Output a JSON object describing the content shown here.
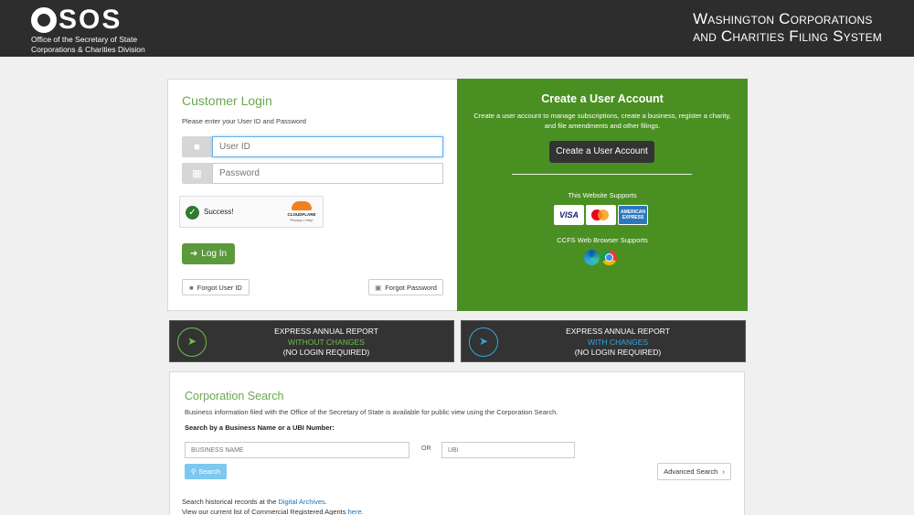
{
  "header": {
    "logo_text": "SOS",
    "logo_line1": "Office of the Secretary of State",
    "logo_line2": "Corporations & Charities Division",
    "title_line1": "Washington Corporations",
    "title_line2": "and Charities Filing System"
  },
  "login": {
    "title": "Customer Login",
    "subtitle": "Please enter your User ID and Password",
    "userid_placeholder": "User ID",
    "password_placeholder": "Password",
    "captcha_status": "Success!",
    "captcha_brand": "CLOUDFLARE",
    "captcha_links": "Privacy • Help",
    "login_button": "Log In",
    "forgot_userid": "Forgot User ID",
    "forgot_password": "Forgot Password"
  },
  "create": {
    "title": "Create a User Account",
    "description": "Create a user account to manage subscriptions, create a business, register a charity, and file amendments and other filings.",
    "button": "Create a User Account",
    "website_supports": "This Website Supports",
    "cards": [
      "VISA",
      "MasterCard",
      "AMERICAN EXPRESS"
    ],
    "browser_supports": "CCFS Web Browser Supports",
    "browsers": [
      "edge-icon",
      "chrome-icon"
    ]
  },
  "express": [
    {
      "line1": "EXPRESS ANNUAL REPORT",
      "line2": "WITHOUT CHANGES",
      "line3": "(NO LOGIN REQUIRED)",
      "accent": "#6cc04a"
    },
    {
      "line1": "EXPRESS ANNUAL REPORT",
      "line2": "WITH CHANGES",
      "line3": "(NO LOGIN REQUIRED)",
      "accent": "#2ea7e0"
    }
  ],
  "corp_search": {
    "title": "Corporation Search",
    "description": "Business information filed with the Office of the Secretary of State is available for public view using the Corporation Search.",
    "label": "Search by a Business Name or a UBI Number:",
    "business_placeholder": "BUSINESS NAME",
    "or": "OR",
    "ubi_placeholder": "UBI",
    "search_button": "Search",
    "advanced_button": "Advanced Search",
    "historical_prefix": "Search historical records at the ",
    "historical_link": "Digital Archives",
    "historical_suffix": ".",
    "agents_prefix": "View our current list of Commercial Registered Agents ",
    "agents_link": "here",
    "agents_suffix": "."
  },
  "colors": {
    "header_bg": "#2d2d2d",
    "brand_green": "#6aa84f",
    "create_bg": "#4a8f22",
    "link_blue": "#1a73b8"
  }
}
